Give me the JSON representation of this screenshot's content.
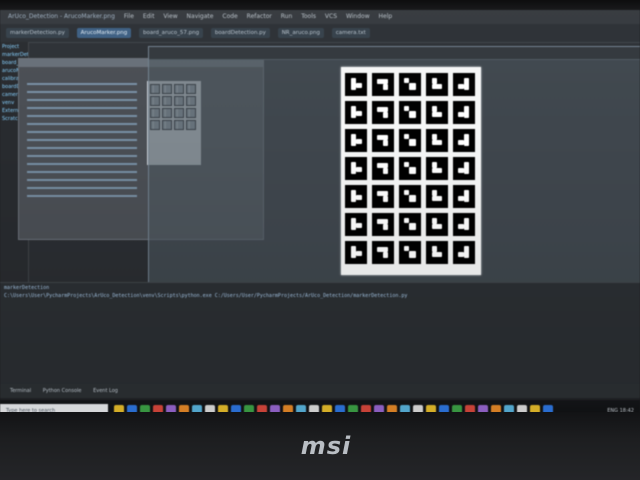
{
  "app": {
    "window_title": "ArUco_Detection - ArucoMarker.png"
  },
  "menu": {
    "items": [
      "File",
      "Edit",
      "View",
      "Navigate",
      "Code",
      "Refactor",
      "Run",
      "Tools",
      "VCS",
      "Window",
      "Help"
    ]
  },
  "tabs": {
    "items": [
      "markerDetection.py",
      "ArucoMarker.png",
      "board_aruco_57.png",
      "boardDetection.py",
      "NR_aruco.png",
      "camera.txt"
    ],
    "active_index": 1
  },
  "sidebar": {
    "items": [
      "Project",
      "markerDetection",
      "board_aruco_57.png",
      "arucoMarker.png",
      "calibration.py",
      "boardDetection.py",
      "camera.txt",
      "venv",
      "External Libraries",
      "Scratches and Consoles"
    ]
  },
  "viewer": {
    "image_name": "ArucoMarker.png",
    "marker_rows": 7,
    "marker_cols": 5
  },
  "terminal": {
    "header": "markerDetection",
    "command_line": "C:\\Users\\User\\PycharmProjects\\ArUco_Detection\\venv\\Scripts\\python.exe C:/Users/User/PycharmProjects/ArUco_Detection/markerDetection.py"
  },
  "status_bar": {
    "left": "Terminal",
    "middle": "Python Console",
    "right": "Event Log"
  },
  "taskbar": {
    "search_placeholder": "Type here to search",
    "tray_text": "ENG 18:42"
  },
  "branding": {
    "label": "msi"
  }
}
